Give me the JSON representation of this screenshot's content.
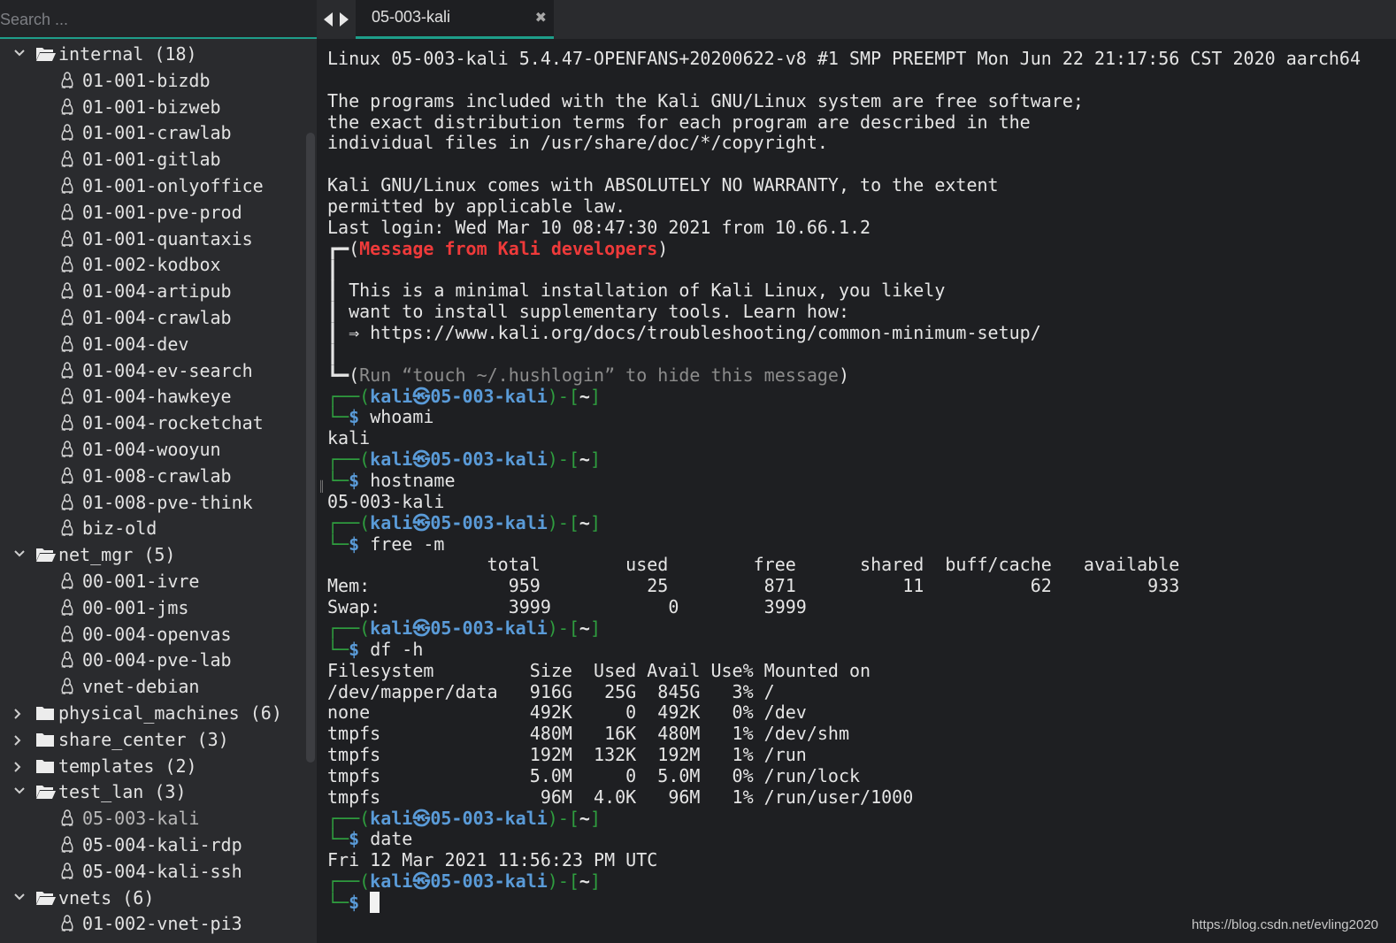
{
  "search": {
    "placeholder": "Search ..."
  },
  "tab": {
    "title": "05-003-kali",
    "close_glyph": "✖"
  },
  "tree": [
    {
      "type": "folder",
      "open": true,
      "label": "internal (18)"
    },
    {
      "type": "host",
      "label": "01-001-bizdb"
    },
    {
      "type": "host",
      "label": "01-001-bizweb"
    },
    {
      "type": "host",
      "label": "01-001-crawlab"
    },
    {
      "type": "host",
      "label": "01-001-gitlab"
    },
    {
      "type": "host",
      "label": "01-001-onlyoffice"
    },
    {
      "type": "host",
      "label": "01-001-pve-prod"
    },
    {
      "type": "host",
      "label": "01-001-quantaxis"
    },
    {
      "type": "host",
      "label": "01-002-kodbox"
    },
    {
      "type": "host",
      "label": "01-004-artipub"
    },
    {
      "type": "host",
      "label": "01-004-crawlab"
    },
    {
      "type": "host",
      "label": "01-004-dev"
    },
    {
      "type": "host",
      "label": "01-004-ev-search"
    },
    {
      "type": "host",
      "label": "01-004-hawkeye"
    },
    {
      "type": "host",
      "label": "01-004-rocketchat"
    },
    {
      "type": "host",
      "label": "01-004-wooyun"
    },
    {
      "type": "host",
      "label": "01-008-crawlab"
    },
    {
      "type": "host",
      "label": "01-008-pve-think"
    },
    {
      "type": "host",
      "label": "biz-old"
    },
    {
      "type": "folder",
      "open": true,
      "label": "net_mgr (5)"
    },
    {
      "type": "host",
      "label": "00-001-ivre"
    },
    {
      "type": "host",
      "label": "00-001-jms"
    },
    {
      "type": "host",
      "label": "00-004-openvas"
    },
    {
      "type": "host",
      "label": "00-004-pve-lab"
    },
    {
      "type": "host",
      "label": "vnet-debian"
    },
    {
      "type": "folder",
      "open": false,
      "label": "physical_machines (6)"
    },
    {
      "type": "folder",
      "open": false,
      "label": "share_center (3)"
    },
    {
      "type": "folder",
      "open": false,
      "label": "templates (2)"
    },
    {
      "type": "folder",
      "open": true,
      "label": "test_lan (3)"
    },
    {
      "type": "host",
      "label": "05-003-kali",
      "selected": true
    },
    {
      "type": "host",
      "label": "05-004-kali-rdp"
    },
    {
      "type": "host",
      "label": "05-004-kali-ssh"
    },
    {
      "type": "folder",
      "open": true,
      "label": "vnets (6)"
    },
    {
      "type": "host",
      "label": "01-002-vnet-pi3"
    }
  ],
  "terminal": {
    "prompt": {
      "user": "kali",
      "at": "㉿",
      "host": "05-003-kali",
      "dir": "~"
    },
    "lines": [
      {
        "kind": "text",
        "text": "Linux 05-003-kali 5.4.47-OPENFANS+20200622-v8 #1 SMP PREEMPT Mon Jun 22 21:17:56 CST 2020 aarch64"
      },
      {
        "kind": "blank"
      },
      {
        "kind": "text",
        "text": "The programs included with the Kali GNU/Linux system are free software;"
      },
      {
        "kind": "text",
        "text": "the exact distribution terms for each program are described in the"
      },
      {
        "kind": "text",
        "text": "individual files in /usr/share/doc/*/copyright."
      },
      {
        "kind": "blank"
      },
      {
        "kind": "text",
        "text": "Kali GNU/Linux comes with ABSOLUTELY NO WARRANTY, to the extent"
      },
      {
        "kind": "text",
        "text": "permitted by applicable law."
      },
      {
        "kind": "text",
        "text": "Last login: Wed Mar 10 08:47:30 2021 from 10.66.1.2"
      },
      {
        "kind": "msghead",
        "pre": "┏━(",
        "text": "Message from Kali developers",
        "post": ")"
      },
      {
        "kind": "text",
        "text": "┃"
      },
      {
        "kind": "text",
        "text": "┃ This is a minimal installation of Kali Linux, you likely"
      },
      {
        "kind": "text",
        "text": "┃ want to install supplementary tools. Learn how:"
      },
      {
        "kind": "text",
        "text": "┃ ⇒ https://www.kali.org/docs/troubleshooting/common-minimum-setup/"
      },
      {
        "kind": "text",
        "text": "┃"
      },
      {
        "kind": "msgfoot",
        "pre": "┗━(",
        "text": "Run “touch ~/.hushlogin” to hide this message",
        "post": ")"
      },
      {
        "kind": "prompt"
      },
      {
        "kind": "cmd",
        "text": "whoami"
      },
      {
        "kind": "text",
        "text": "kali"
      },
      {
        "kind": "prompt"
      },
      {
        "kind": "cmd",
        "text": "hostname"
      },
      {
        "kind": "text",
        "text": "05-003-kali"
      },
      {
        "kind": "prompt"
      },
      {
        "kind": "cmd",
        "text": "free -m"
      },
      {
        "kind": "text",
        "text": "               total        used        free      shared  buff/cache   available"
      },
      {
        "kind": "text",
        "text": "Mem:             959          25         871          11          62         933"
      },
      {
        "kind": "text",
        "text": "Swap:            3999           0        3999"
      },
      {
        "kind": "prompt"
      },
      {
        "kind": "cmd",
        "text": "df -h"
      },
      {
        "kind": "text",
        "text": "Filesystem         Size  Used Avail Use% Mounted on"
      },
      {
        "kind": "text",
        "text": "/dev/mapper/data   916G   25G  845G   3% /"
      },
      {
        "kind": "text",
        "text": "none               492K     0  492K   0% /dev"
      },
      {
        "kind": "text",
        "text": "tmpfs              480M   16K  480M   1% /dev/shm"
      },
      {
        "kind": "text",
        "text": "tmpfs              192M  132K  192M   1% /run"
      },
      {
        "kind": "text",
        "text": "tmpfs              5.0M     0  5.0M   0% /run/lock"
      },
      {
        "kind": "text",
        "text": "tmpfs               96M  4.0K   96M   1% /run/user/1000"
      },
      {
        "kind": "prompt"
      },
      {
        "kind": "cmd",
        "text": "date"
      },
      {
        "kind": "text",
        "text": "Fri 12 Mar 2021 11:56:23 PM UTC"
      },
      {
        "kind": "prompt"
      },
      {
        "kind": "cursor"
      }
    ]
  },
  "watermark": "https://blog.csdn.net/evling2020",
  "colors": {
    "accent": "#1e9e8a",
    "msg_red": "#ef3a3a",
    "prompt_blue": "#5a9bd8",
    "prompt_green": "#2f9e3f"
  }
}
